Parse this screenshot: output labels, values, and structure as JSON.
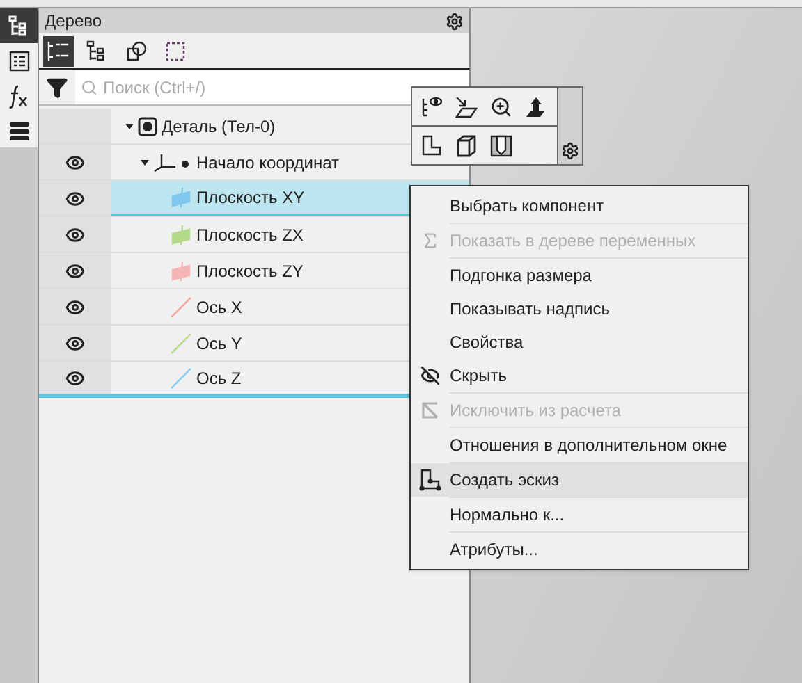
{
  "rail": [
    {
      "selected": true
    },
    {
      "selected": false
    },
    {
      "selected": false
    },
    {
      "selected": false
    }
  ],
  "panel": {
    "title": "Дерево",
    "toolbar": [
      {
        "selected": true
      },
      {
        "selected": false
      },
      {
        "selected": false
      },
      {
        "selected": false
      }
    ],
    "search": {
      "placeholder": "Поиск (Ctrl+/)"
    },
    "tree": [
      {
        "label": "Деталь (Тел-0)",
        "kind": "part",
        "visible": false,
        "selected": false,
        "expanded": true,
        "children": [
          {
            "label": "Начало координат",
            "kind": "origin",
            "visible": true,
            "selected": false,
            "expanded": true,
            "children": [
              {
                "label": "Плоскость XY",
                "kind": "plane",
                "color": "#7ec8f0",
                "visible": true,
                "selected": true
              },
              {
                "label": "Плоскость ZX",
                "kind": "plane",
                "color": "#b5d98a",
                "visible": true,
                "selected": false
              },
              {
                "label": "Плоскость ZY",
                "kind": "plane",
                "color": "#f5b5b5",
                "visible": true,
                "selected": false
              },
              {
                "label": "Ось X",
                "kind": "axis",
                "color": "#f0a0a0",
                "visible": true,
                "selected": false
              },
              {
                "label": "Ось Y",
                "kind": "axis",
                "color": "#b5d98a",
                "visible": true,
                "selected": false
              },
              {
                "label": "Ось Z",
                "kind": "axis",
                "color": "#7ec8f0",
                "visible": true,
                "selected": false
              }
            ]
          }
        ]
      }
    ]
  },
  "context_menu": {
    "groups": [
      [
        {
          "label": "Выбрать компонент",
          "kind": "plain",
          "disabled": false,
          "selected": false
        }
      ],
      [
        {
          "label": "Показать в дереве переменных",
          "kind": "fx",
          "disabled": true,
          "selected": false
        }
      ],
      [
        {
          "label": "Подгонка размера",
          "kind": "plain",
          "disabled": false,
          "selected": false
        },
        {
          "label": "Показывать надпись",
          "kind": "plain",
          "disabled": false,
          "selected": false
        },
        {
          "label": "Свойства",
          "kind": "plain",
          "disabled": false,
          "selected": false
        },
        {
          "label": "Скрыть",
          "kind": "hide",
          "disabled": false,
          "selected": false
        }
      ],
      [
        {
          "label": "Исключить из расчета",
          "kind": "exclude",
          "disabled": true,
          "selected": false
        }
      ],
      [
        {
          "label": "Отношения в дополнительном окне",
          "kind": "plain",
          "disabled": false,
          "selected": false
        }
      ],
      [
        {
          "label": "Создать эскиз",
          "kind": "sketch",
          "disabled": false,
          "selected": true
        }
      ],
      [
        {
          "label": "Нормально к...",
          "kind": "plain",
          "disabled": false,
          "selected": false
        }
      ],
      [
        {
          "label": "Атрибуты...",
          "kind": "plain",
          "disabled": false,
          "selected": false
        }
      ]
    ]
  }
}
